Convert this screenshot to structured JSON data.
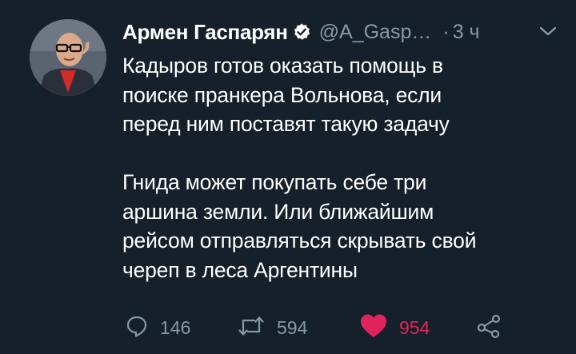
{
  "tweet": {
    "author_name": "Армен Гаспарян",
    "handle": "@A_Gasp…",
    "separator": "·",
    "time": "3 ч",
    "text": [
      "Кадыров готов оказать помощь в",
      "поиске пранкера Вольнова, если",
      "перед ним поставят такую задачу"
    ],
    "text2": [
      "Гнида может покупать себе три",
      "аршина земли. Или ближайшим",
      "рейсом отправляться скрывать свой",
      "череп в леса Аргентины"
    ]
  },
  "actions": {
    "reply_count": "146",
    "retweet_count": "594",
    "like_count": "954"
  },
  "icons": {
    "verified": "verified-badge-icon",
    "caret": "chevron-down-icon",
    "reply": "reply-icon",
    "retweet": "retweet-icon",
    "like": "heart-icon",
    "share": "share-icon"
  },
  "colors": {
    "background": "#15202b",
    "text": "#ffffff",
    "secondary": "#8899a6",
    "like": "#e0245e"
  }
}
